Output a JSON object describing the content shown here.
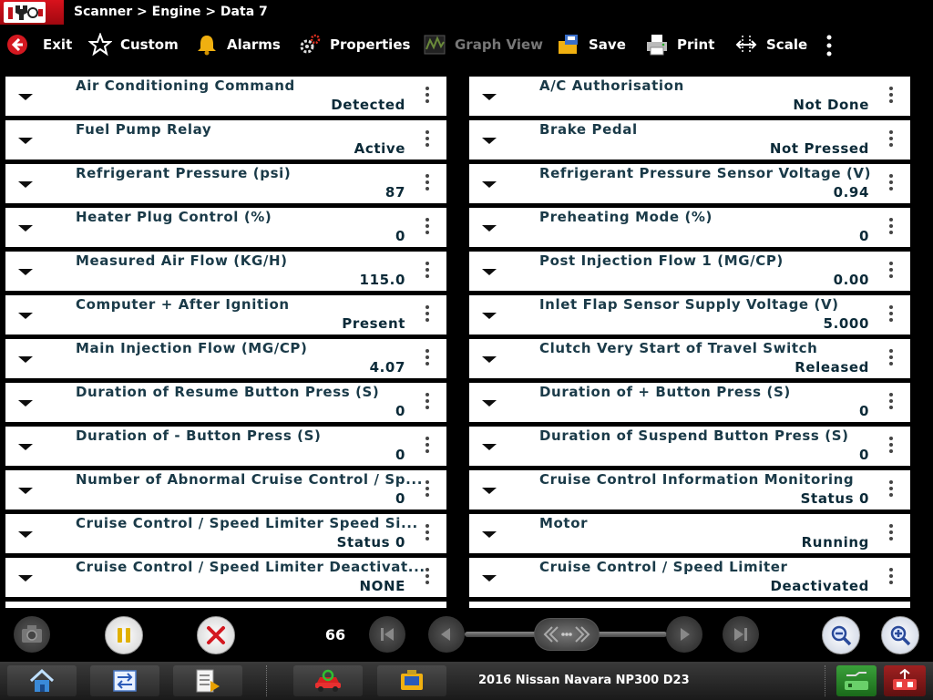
{
  "header": {
    "breadcrumb": "Scanner > Engine > Data 7"
  },
  "toolbar": {
    "exit_label": "Exit",
    "custom_label": "Custom",
    "alarms_label": "Alarms",
    "properties_label": "Properties",
    "graph_view_label": "Graph View",
    "save_label": "Save",
    "print_label": "Print",
    "scale_label": "Scale"
  },
  "left_params": [
    {
      "name": "Air Conditioning Command",
      "value": "Detected"
    },
    {
      "name": "Fuel Pump Relay",
      "value": "Active"
    },
    {
      "name": "Refrigerant Pressure (psi)",
      "value": "87"
    },
    {
      "name": "Heater Plug Control (%)",
      "value": "0"
    },
    {
      "name": "Measured Air Flow (KG/H)",
      "value": "115.0"
    },
    {
      "name": "Computer + After Ignition",
      "value": "Present"
    },
    {
      "name": "Main Injection Flow (MG/CP)",
      "value": "4.07"
    },
    {
      "name": "Duration of Resume Button Press (S)",
      "value": "0"
    },
    {
      "name": "Duration of - Button Press (S)",
      "value": "0"
    },
    {
      "name": "Number of Abnormal Cruise Control / Sp...",
      "value": "0"
    },
    {
      "name": "Cruise Control / Speed Limiter Speed Si...",
      "value": "Status 0"
    },
    {
      "name": "Cruise Control / Speed Limiter Deactivat...",
      "value": "NONE"
    }
  ],
  "right_params": [
    {
      "name": "A/C Authorisation",
      "value": "Not Done"
    },
    {
      "name": "Brake Pedal",
      "value": "Not Pressed"
    },
    {
      "name": "Refrigerant Pressure Sensor Voltage (V)",
      "value": "0.94"
    },
    {
      "name": "Preheating Mode (%)",
      "value": "0"
    },
    {
      "name": "Post Injection Flow 1 (MG/CP)",
      "value": "0.00"
    },
    {
      "name": "Inlet Flap Sensor Supply Voltage (V)",
      "value": "5.000"
    },
    {
      "name": "Clutch Very Start of Travel Switch",
      "value": "Released"
    },
    {
      "name": "Duration of + Button Press (S)",
      "value": "0"
    },
    {
      "name": "Duration of Suspend Button Press (S)",
      "value": "0"
    },
    {
      "name": "Cruise Control Information Monitoring",
      "value": "Status 0"
    },
    {
      "name": "Motor",
      "value": "Running"
    },
    {
      "name": "Cruise Control / Speed Limiter",
      "value": "Deactivated"
    }
  ],
  "playback": {
    "frame_count": "66"
  },
  "taskbar": {
    "vehicle": "2016 Nissan Navara NP300 D23"
  },
  "colors": {
    "brand_red": "#d8121c",
    "row_background": "#ffffff",
    "param_text": "#1a3a48"
  }
}
